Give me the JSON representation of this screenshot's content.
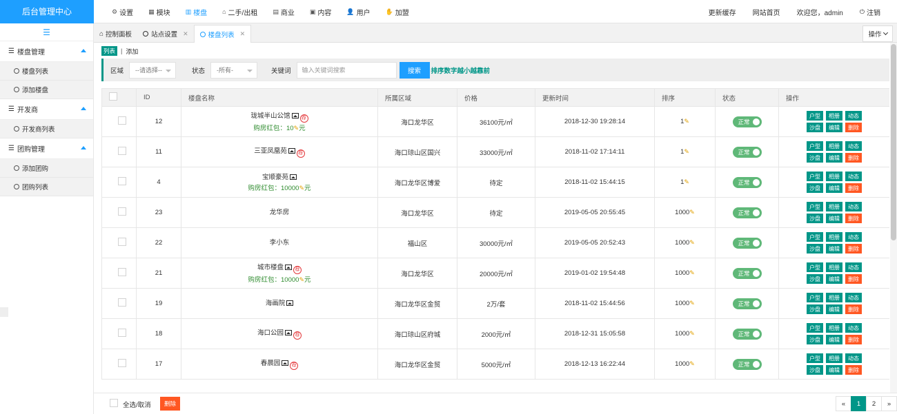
{
  "brand": "后台管理中心",
  "topnav": [
    {
      "icon": "gear-icon",
      "glyph": "⚙",
      "label": "设置"
    },
    {
      "icon": "grid-icon",
      "glyph": "▦",
      "label": "模块"
    },
    {
      "icon": "building-icon",
      "glyph": "▥",
      "label": "楼盘"
    },
    {
      "icon": "home-icon",
      "glyph": "⌂",
      "label": "二手/出租"
    },
    {
      "icon": "shop-icon",
      "glyph": "▤",
      "label": "商业"
    },
    {
      "icon": "content-icon",
      "glyph": "▣",
      "label": "内容"
    },
    {
      "icon": "user-icon",
      "glyph": "👤",
      "label": "用户"
    },
    {
      "icon": "join-icon",
      "glyph": "✋",
      "label": "加盟"
    }
  ],
  "topright": {
    "refresh": "更新缓存",
    "site_home": "网站首页",
    "welcome": "欢迎您，admin",
    "logout": "注销"
  },
  "sidebar": {
    "groups": [
      {
        "title": "楼盘管理",
        "items": [
          "楼盘列表",
          "添加楼盘"
        ]
      },
      {
        "title": "开发商",
        "items": [
          "开发商列表"
        ]
      },
      {
        "title": "团购管理",
        "items": [
          "添加团购",
          "团购列表"
        ]
      }
    ]
  },
  "tabs": [
    {
      "label": "控制面板"
    },
    {
      "label": "站点设置"
    },
    {
      "label": "楼盘列表"
    }
  ],
  "tab_ops": "操作",
  "sublinks": {
    "list": "列表",
    "add": "添加"
  },
  "filter": {
    "region_label": "区域",
    "region_value": "--请选择--",
    "status_label": "状态",
    "status_value": "-所有-",
    "keyword_label": "关键词",
    "keyword_placeholder": "输入关键词搜索",
    "search_btn": "搜索",
    "hint": "排序数字越小越靠前"
  },
  "table": {
    "headers": [
      "ID",
      "楼盘名称",
      "所属区域",
      "价格",
      "更新时间",
      "排序",
      "状态",
      "操作"
    ],
    "rows": [
      {
        "id": "12",
        "name": "珑城半山公馆",
        "pic": true,
        "hot": true,
        "red_label": "购房红包：",
        "red_value": "10",
        "red_unit": "元",
        "region": "海口龙华区",
        "price": "36100元/㎡",
        "time": "2018-12-30 19:28:14",
        "sort": "1",
        "status": "正常"
      },
      {
        "id": "11",
        "name": "三亚凤凰苑",
        "pic": true,
        "hot": true,
        "region": "海口琼山区国兴",
        "price": "33000元/㎡",
        "time": "2018-11-02 17:14:11",
        "sort": "1",
        "status": "正常"
      },
      {
        "id": "4",
        "name": "宝顺豪苑",
        "pic": true,
        "hot": false,
        "red_label": "购房红包：",
        "red_value": "10000",
        "red_unit": "元",
        "region": "海口龙华区博爱",
        "price": "待定",
        "time": "2018-11-02 15:44:15",
        "sort": "1",
        "status": "正常"
      },
      {
        "id": "23",
        "name": "龙华房",
        "pic": false,
        "hot": false,
        "region": "海口龙华区",
        "price": "待定",
        "time": "2019-05-05 20:55:45",
        "sort": "1000",
        "status": "正常"
      },
      {
        "id": "22",
        "name": "李小东",
        "pic": false,
        "hot": false,
        "region": "福山区",
        "price": "30000元/㎡",
        "time": "2019-05-05 20:52:43",
        "sort": "1000",
        "status": "正常"
      },
      {
        "id": "21",
        "name": "城市楼盘",
        "pic": true,
        "hot": true,
        "red_label": "购房红包：",
        "red_value": "10000",
        "red_unit": "元",
        "region": "海口龙华区",
        "price": "20000元/㎡",
        "time": "2019-01-02 19:54:48",
        "sort": "1000",
        "status": "正常"
      },
      {
        "id": "19",
        "name": "海画院",
        "pic": true,
        "hot": false,
        "region": "海口龙华区金贸",
        "price": "2万/套",
        "time": "2018-11-02 15:44:56",
        "sort": "1000",
        "status": "正常"
      },
      {
        "id": "18",
        "name": "海口公园",
        "pic": true,
        "hot": true,
        "region": "海口琼山区府城",
        "price": "2000元/㎡",
        "time": "2018-12-31 15:05:58",
        "sort": "1000",
        "status": "正常"
      },
      {
        "id": "17",
        "name": "春晨园",
        "pic": true,
        "hot": true,
        "region": "海口龙华区金贸",
        "price": "5000元/㎡",
        "time": "2018-12-13 16:22:44",
        "sort": "1000",
        "status": "正常"
      }
    ],
    "ops": [
      "户型",
      "相册",
      "动态",
      "沙盘",
      "编辑",
      "删除"
    ],
    "hot_glyph": "荐"
  },
  "bottom": {
    "select_all": "全选/取消",
    "delete": "删除"
  },
  "pager": {
    "prev": "«",
    "pages": [
      "1",
      "2"
    ],
    "next": "»",
    "current": "1"
  }
}
